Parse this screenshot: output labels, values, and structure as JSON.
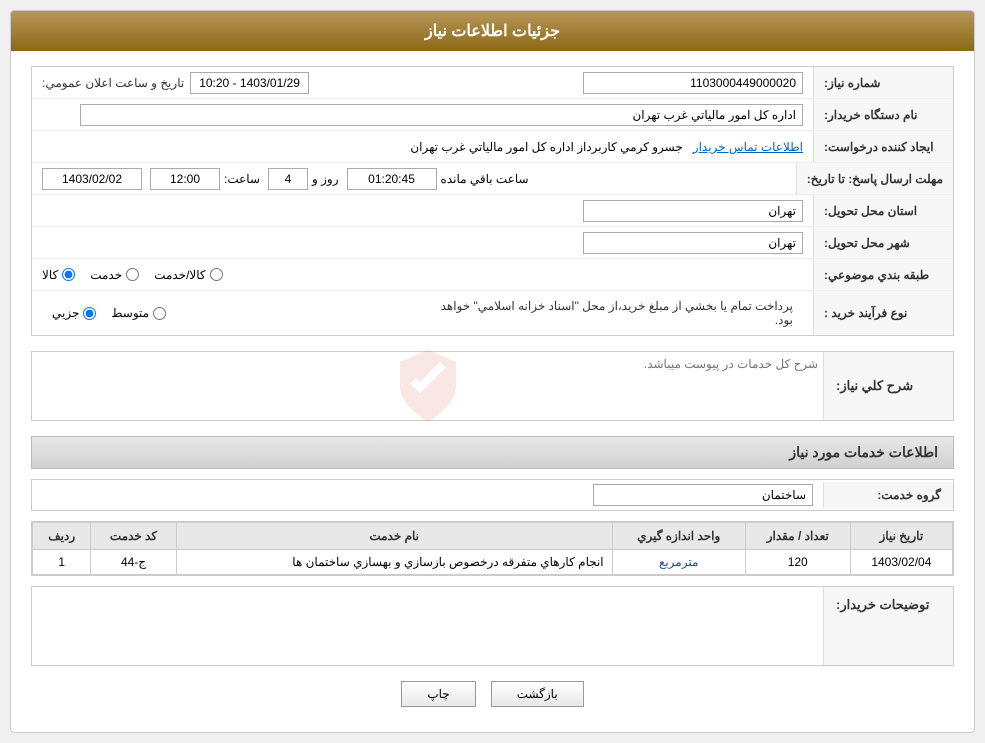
{
  "header": {
    "title": "جزئيات اطلاعات نياز"
  },
  "fields": {
    "need_number_label": "شماره نياز:",
    "need_number_value": "1103000449000020",
    "announcement_date_label": "تاريخ و ساعت اعلان عمومي:",
    "announcement_date_value": "1403/01/29 - 10:20",
    "buyer_org_label": "نام دستگاه خريدار:",
    "buyer_org_value": "اداره کل امور مالياتي غرب تهران",
    "creator_label": "ايجاد کننده درخواست:",
    "creator_value": "جسرو کرمي کاربرداز اداره کل امور مالياتي غرب تهران",
    "contact_link": "اطلاعات تماس خريدار",
    "reply_deadline_label": "مهلت ارسال پاسخ: تا تاريخ:",
    "date_value": "1403/02/02",
    "time_label": "ساعت:",
    "time_value": "12:00",
    "days_label": "روز و",
    "days_value": "4",
    "hours_label": "ساعت باقي مانده",
    "hours_value": "01:20:45",
    "province_label": "استان محل تحويل:",
    "province_value": "تهران",
    "city_label": "شهر محل تحويل:",
    "city_value": "تهران",
    "category_label": "طبقه بندي موضوعي:",
    "cat_kala": "کالا",
    "cat_khedmat": "خدمت",
    "cat_kala_khedmat": "کالا/خدمت",
    "purchase_type_label": "نوع فرآيند خريد :",
    "type_jozvi": "جزيي",
    "type_mottavaset": "متوسط",
    "purchase_notice": "پرداخت تمام يا بخشي از مبلغ خريد،از محل \"اسناد خزانه اسلامي\" خواهد بود.",
    "general_desc_label": "شرح کلي نياز:",
    "general_desc_placeholder": "شرح کل خدمات در پيوست ميباشد.",
    "services_section_title": "اطلاعات خدمات مورد نياز",
    "service_group_label": "گروه خدمت:",
    "service_group_value": "ساختمان",
    "table_headers": {
      "row_num": "رديف",
      "service_code": "کد خدمت",
      "service_name": "نام خدمت",
      "unit": "واحد اندازه گيري",
      "qty": "تعداد / مقدار",
      "date": "تاريخ نياز"
    },
    "table_rows": [
      {
        "row_num": "1",
        "service_code": "ج-44",
        "service_name": "انجام کارهاي متفرقه درخصوص بازسازي و بهسازي ساختمان ها",
        "unit": "مترمربع",
        "qty": "120",
        "date": "1403/02/04"
      }
    ],
    "buyer_comments_label": "توضيحات خريدار:",
    "buyer_comments_placeholder": ""
  },
  "buttons": {
    "print": "چاپ",
    "back": "بازگشت"
  },
  "colors": {
    "header_bg": "#8b6914",
    "accent": "#b8965a"
  }
}
